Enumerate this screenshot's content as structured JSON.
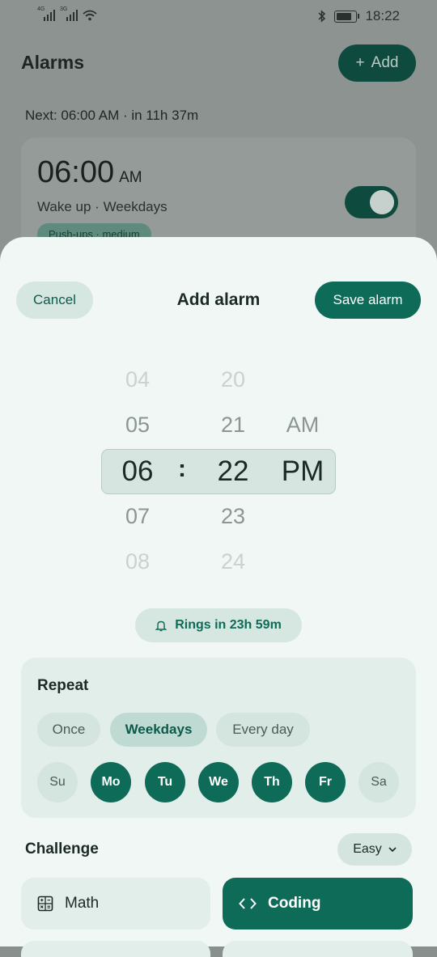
{
  "status_bar": {
    "net1": "4G",
    "net2": "3G",
    "time": "18:22"
  },
  "background": {
    "title": "Alarms",
    "add_label": "Add",
    "next_text": "Next: 06:00 AM · in 11h 37m",
    "card": {
      "time": "06:00",
      "ampm": "AM",
      "subtitle": "Wake up · Weekdays",
      "chip": "Push-ups · medium",
      "enabled": true
    }
  },
  "sheet": {
    "cancel_label": "Cancel",
    "title": "Add alarm",
    "save_label": "Save alarm",
    "picker": {
      "hours": [
        "04",
        "05",
        "06",
        "07",
        "08"
      ],
      "minutes": [
        "20",
        "21",
        "22",
        "23",
        "24"
      ],
      "ampm": [
        "AM",
        "PM"
      ],
      "separator": ":"
    },
    "rings_text": "Rings in 23h 59m",
    "repeat": {
      "heading": "Repeat",
      "options": [
        "Once",
        "Weekdays",
        "Every day"
      ],
      "selected_option": "Weekdays",
      "days": [
        "Su",
        "Mo",
        "Tu",
        "We",
        "Th",
        "Fr",
        "Sa"
      ],
      "days_on": [
        false,
        true,
        true,
        true,
        true,
        true,
        false
      ]
    },
    "challenge": {
      "heading": "Challenge",
      "difficulty": "Easy",
      "options": [
        {
          "label": "Math",
          "icon": "calculator-icon",
          "selected": false
        },
        {
          "label": "Coding",
          "icon": "code-icon",
          "selected": true
        }
      ]
    }
  },
  "colors": {
    "accent": "#0d6b58",
    "accent_light": "#d6e6e1",
    "sheet_bg": "#f1f7f5"
  }
}
